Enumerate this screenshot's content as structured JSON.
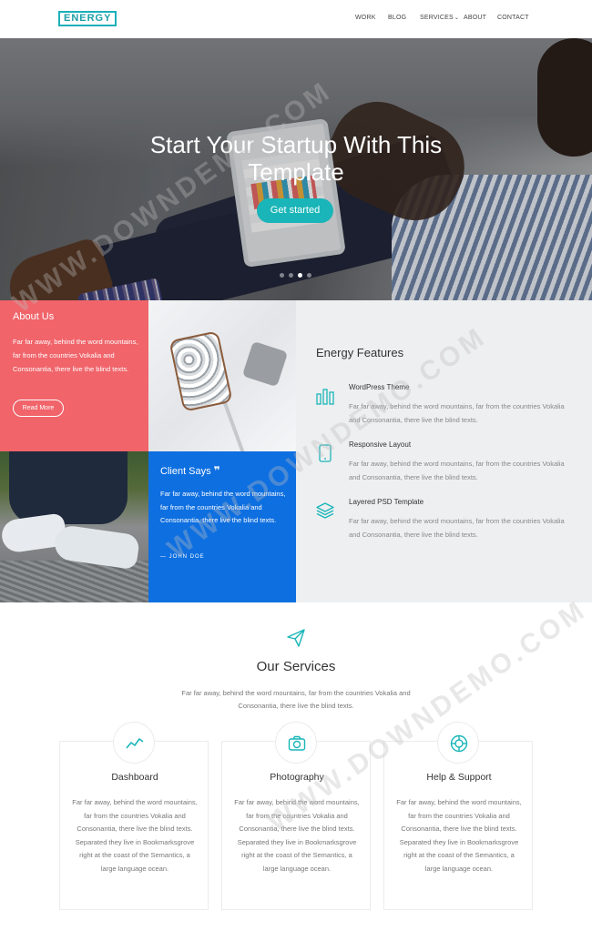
{
  "header": {
    "logo": "ENERGY",
    "nav": [
      {
        "label": "WORK"
      },
      {
        "label": "BLOG"
      },
      {
        "label": "SERVICES"
      },
      {
        "label": "ABOUT"
      },
      {
        "label": "CONTACT"
      }
    ]
  },
  "hero": {
    "title": "Start Your Startup With This Template",
    "cta": "Get started",
    "slides": 3,
    "active_slide": 2
  },
  "about": {
    "title": "About Us",
    "text": "Far far away, behind the word mountains, far from the countries Vokalia and Consonantia, there live the blind texts.",
    "button": "Read More"
  },
  "client": {
    "title": "Client Says",
    "quote_mark": "❞",
    "text": "Far far away, behind the word mountains, far from the countries Vokalia and Consonantia, there live the blind texts.",
    "author": "— JOHN DOE"
  },
  "features": {
    "title": "Energy Features",
    "items": [
      {
        "title": "WordPress Theme",
        "text": "Far far away, behind the word mountains, far from the countries Vokalia and Consonantia, there live the blind texts.",
        "icon": "bar-chart-icon"
      },
      {
        "title": "Responsive Layout",
        "text": "Far far away, behind the word mountains, far from the countries Vokalia and Consonantia, there live the blind texts.",
        "icon": "mobile-icon"
      },
      {
        "title": "Layered PSD Template",
        "text": "Far far away, behind the word mountains, far from the countries Vokalia and Consonantia, there live the blind texts.",
        "icon": "layers-icon"
      }
    ]
  },
  "services": {
    "title": "Our Services",
    "text": "Far far away, behind the word mountains, far from the countries Vokalia and Consonantia, there live the blind texts.",
    "cards": [
      {
        "title": "Dashboard",
        "icon": "line-chart-icon",
        "text": "Far far away, behind the word mountains, far from the countries Vokalia and Consonantia, there live the blind texts. Separated they live in Bookmarksgrove right at the coast of the Semantics, a large language ocean."
      },
      {
        "title": "Photography",
        "icon": "camera-icon",
        "text": "Far far away, behind the word mountains, far from the countries Vokalia and Consonantia, there live the blind texts. Separated they live in Bookmarksgrove right at the coast of the Semantics, a large language ocean."
      },
      {
        "title": "Help & Support",
        "icon": "lifebuoy-icon",
        "text": "Far far away, behind the word mountains, far from the countries Vokalia and Consonantia, there live the blind texts. Separated they live in Bookmarksgrove right at the coast of the Semantics, a large language ocean."
      }
    ]
  },
  "watermark": "WWW.DOWNDEMO.COM",
  "colors": {
    "accent": "#1ab5b8",
    "about_bg": "#f0646a",
    "client_bg": "#0e6fe0",
    "features_bg": "#eeeff1"
  }
}
